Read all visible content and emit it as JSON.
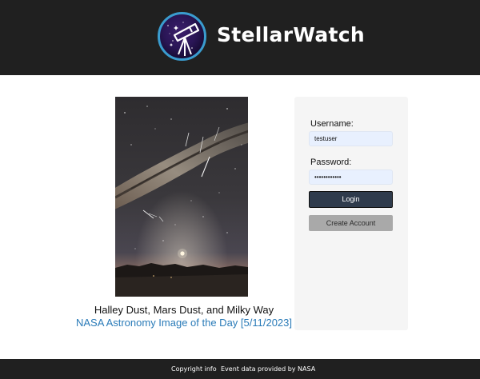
{
  "header": {
    "brand": "StellarWatch",
    "logo_icon": "telescope-icon"
  },
  "feature": {
    "image_icon": "milky-way-photo",
    "caption": "Halley Dust, Mars Dust, and Milky Way",
    "link_text": "NASA Astronomy Image of the Day [5/11/2023]"
  },
  "login": {
    "username_label": "Username:",
    "username_value": "testuser",
    "password_label": "Password:",
    "password_value": "••••••••••••",
    "login_label": "Login",
    "create_label": "Create Account"
  },
  "footer": {
    "copyright": "Copyright info",
    "credit": "Event data provided by NASA"
  },
  "colors": {
    "header_bg": "#202020",
    "link": "#2a7bb8",
    "login_button": "#2f3b4c",
    "create_button": "#a9a9a9",
    "input_bg": "#e8f0fe"
  }
}
